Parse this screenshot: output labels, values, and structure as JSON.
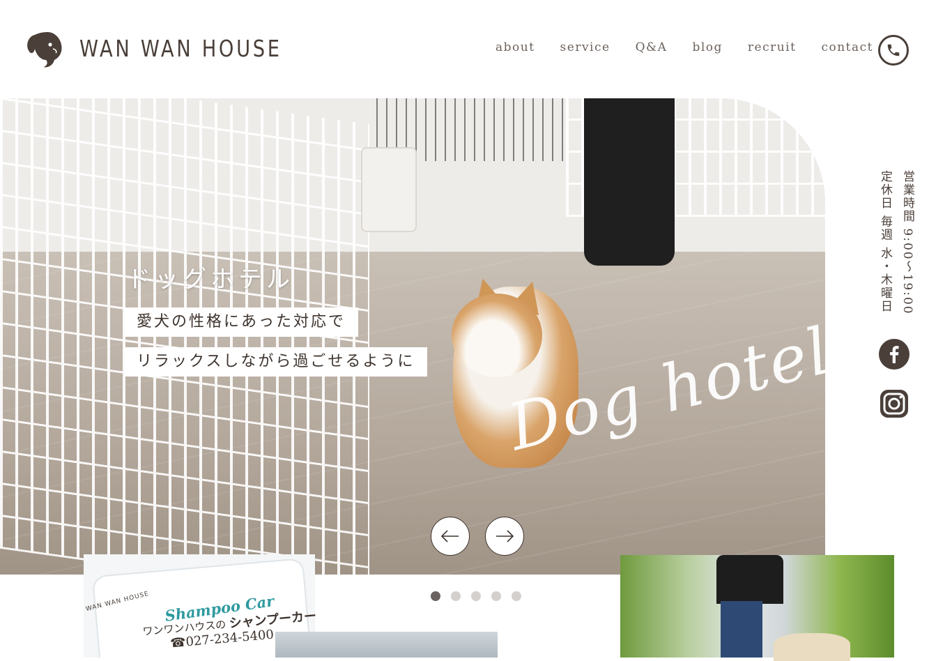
{
  "logo": {
    "text": "WAN WAN HOUSE"
  },
  "nav": {
    "items": [
      "about",
      "service",
      "Q&A",
      "blog",
      "recruit",
      "contact"
    ]
  },
  "hero": {
    "title": "ドッグホテル",
    "lines": [
      "愛犬の性格にあった対応で",
      "リラックスしながら過ごせるように"
    ],
    "script": "Dog hotel"
  },
  "slider": {
    "count": 5,
    "active": 1
  },
  "hours": {
    "line1": "営業時間 9:00〜19:00",
    "line2": "定休日 毎週 水・木曜日"
  },
  "thumbs": {
    "shampoo": {
      "brand": "WAN WAN HOUSE",
      "script": "Shampoo Car",
      "jp_small": "ワンワンハウスの",
      "jp_big": "シャンプーカー",
      "tel": "☎027-234-5400"
    }
  },
  "colors": {
    "brand": "#4a3f39",
    "dot_active": "#6b6361",
    "dot_inactive": "#d3d0cd",
    "car_teal": "#2f9aa0"
  },
  "icons": [
    "logo-dog-icon",
    "phone-icon",
    "facebook-icon",
    "instagram-icon",
    "arrow-left-icon",
    "arrow-right-icon"
  ]
}
